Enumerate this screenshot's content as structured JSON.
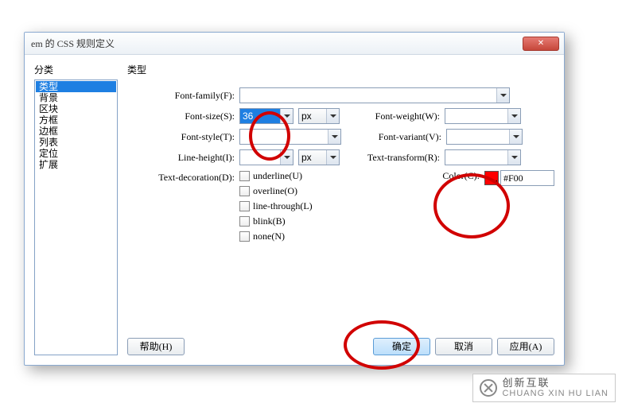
{
  "window": {
    "title": "em 的 CSS 规则定义"
  },
  "close": {
    "glyph": "✕"
  },
  "left_label": "分类",
  "right_label": "类型",
  "categories": [
    "类型",
    "背景",
    "区块",
    "方框",
    "边框",
    "列表",
    "定位",
    "扩展"
  ],
  "labels": {
    "font_family": "Font-family(F):",
    "font_size": "Font-size(S):",
    "font_style": "Font-style(T):",
    "line_height": "Line-height(I):",
    "text_decoration": "Text-decoration(D):",
    "font_weight": "Font-weight(W):",
    "font_variant": "Font-variant(V):",
    "text_transform": "Text-transform(R):",
    "color": "Color(C):"
  },
  "values": {
    "font_family": "",
    "font_size": "36",
    "font_size_unit": "px",
    "font_style": "",
    "line_height": "",
    "line_height_unit": "px",
    "font_weight": "",
    "font_variant": "",
    "text_transform": "",
    "color_hex": "#F00",
    "color_swatch": "#ff0000"
  },
  "decorations": {
    "underline": "underline(U)",
    "overline": "overline(O)",
    "line_through": "line-through(L)",
    "blink": "blink(B)",
    "none": "none(N)"
  },
  "buttons": {
    "help": "帮助(H)",
    "ok": "确定",
    "cancel": "取消",
    "apply": "应用(A)"
  },
  "watermark": {
    "cn": "创新互联",
    "en": "CHUANG XIN HU LIAN"
  }
}
